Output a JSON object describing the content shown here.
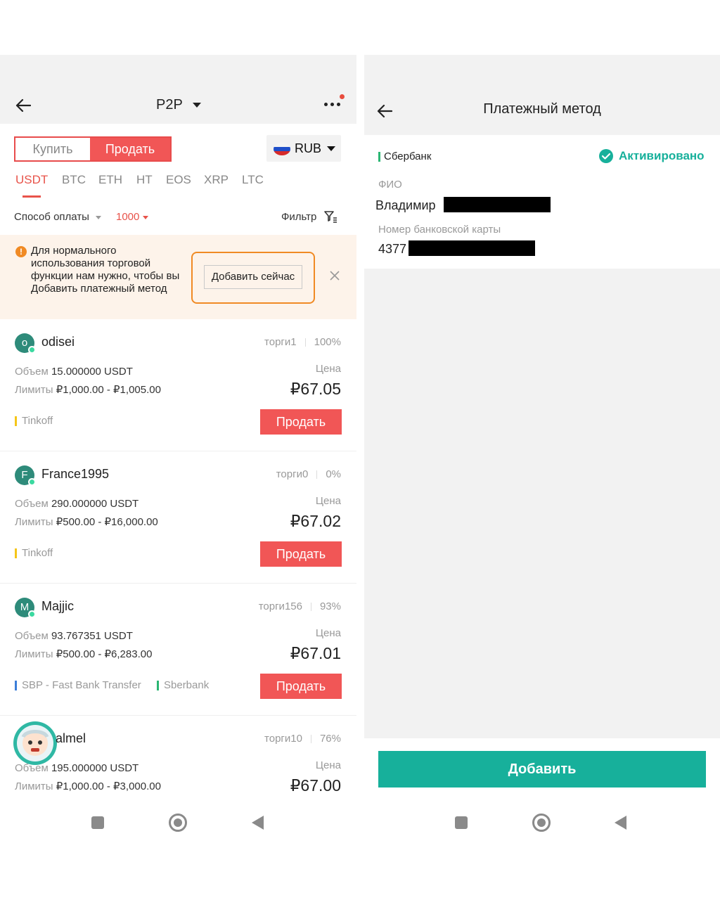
{
  "left": {
    "header": {
      "title": "P2P"
    },
    "toggle": {
      "buy": "Купить",
      "sell": "Продать"
    },
    "currency": "RUB",
    "coin_tabs": [
      "USDT",
      "BTC",
      "ETH",
      "HT",
      "EOS",
      "XRP",
      "LTC"
    ],
    "active_coin": "USDT",
    "filters": {
      "payment_method": "Способ оплаты",
      "amount": "1000",
      "filter": "Фильтр"
    },
    "notice": {
      "text": "Для нормального использования торговой функции нам нужно, чтобы вы Добавить платежный метод",
      "button": "Добавить сейчас"
    },
    "offers": [
      {
        "avatar": "o",
        "name": "odisei",
        "trades": "торги1",
        "completion": "100%",
        "volume_label": "Объем",
        "volume": "15.000000 USDT",
        "limits_label": "Лимиты",
        "limits": "₽1,000.00 - ₽1,005.00",
        "price_label": "Цена",
        "price": "₽67.05",
        "methods": [
          "Tinkoff"
        ],
        "action": "Продать"
      },
      {
        "avatar": "F",
        "name": "France1995",
        "trades": "торги0",
        "completion": "0%",
        "volume_label": "Объем",
        "volume": "290.000000 USDT",
        "limits_label": "Лимиты",
        "limits": "₽500.00 - ₽16,000.00",
        "price_label": "Цена",
        "price": "₽67.02",
        "methods": [
          "Tinkoff"
        ],
        "action": "Продать"
      },
      {
        "avatar": "M",
        "name": "Majjic",
        "trades": "торги156",
        "completion": "93%",
        "volume_label": "Объем",
        "volume": "93.767351 USDT",
        "limits_label": "Лимиты",
        "limits": "₽500.00 - ₽6,283.00",
        "price_label": "Цена",
        "price": "₽67.01",
        "methods": [
          "SBP - Fast Bank Transfer",
          "Sberbank"
        ],
        "action": "Продать"
      },
      {
        "avatar": "",
        "name": "almel",
        "trades": "торги10",
        "completion": "76%",
        "volume_label": "Объем",
        "volume": "195.000000 USDT",
        "limits_label": "Лимиты",
        "limits": "₽1,000.00 - ₽3,000.00",
        "price_label": "Цена",
        "price": "₽67.00",
        "methods": [],
        "action": "Продать"
      }
    ]
  },
  "right": {
    "header": {
      "title": "Платежный метод"
    },
    "bank": "Сбербанк",
    "status": "Активировано",
    "fio_label": "ФИО",
    "fio_value": "Владимир",
    "card_label": "Номер банковской карты",
    "card_value": "4377",
    "add_button": "Добавить"
  },
  "colors": {
    "sell_red": "#f15656",
    "accent_red": "#e8534a",
    "teal": "#17b09b",
    "notice_bg": "#fdf3ea",
    "notice_border": "#f08a24"
  },
  "icons": [
    "back-arrow-icon",
    "caret-down-icon",
    "more-icon",
    "russia-flag-icon",
    "filter-icon",
    "warning-icon",
    "close-icon",
    "check-circle-icon",
    "nav-recents-icon",
    "nav-home-icon",
    "nav-back-icon"
  ]
}
